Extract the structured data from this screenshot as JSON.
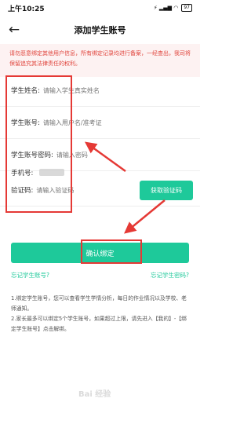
{
  "status_bar": {
    "time": "上午10:25",
    "icons": "⚡ ▂▄▆ ◠",
    "battery": "97"
  },
  "header": {
    "back_icon": "arrow-left-icon",
    "title": "添加学生账号"
  },
  "notice": "请勿恶意绑定其他用户信息，所有绑定记录均进行备案，一经查出，我司将保留追究其法律责任的权利。",
  "form": {
    "name_label": "学生姓名:",
    "name_placeholder": "请输入学生真实姓名",
    "account_label": "学生账号:",
    "account_placeholder": "请输入用户名/准考证",
    "password_label": "学生账号密码:",
    "password_placeholder": "请输入密码",
    "phone_label": "手机号:",
    "code_label": "验证码:",
    "code_placeholder": "请输入验证码",
    "get_code_button": "获取验证码"
  },
  "confirm_button": "确认绑定",
  "links": {
    "forgot_account": "忘记学生账号?",
    "forgot_password": "忘记学生密码?"
  },
  "notes": [
    "1.绑定学生账号，您可以查看学生学情分析，每日的作业情况以及学校、老师通知。",
    "2.家长最多可以绑定5个学生账号，如果超过上限，请先进入【我的】-【绑定学生账号】点击解绑。"
  ],
  "colors": {
    "accent": "#1ec99a",
    "notice_text": "#e0443c",
    "notice_bg": "#fdf2f2",
    "annotation": "#e53935"
  }
}
